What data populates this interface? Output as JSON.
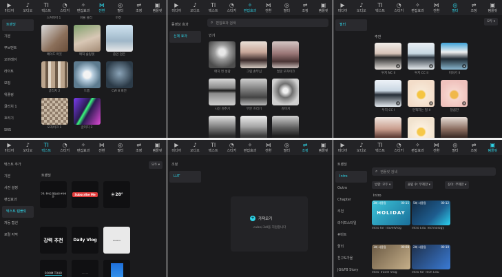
{
  "tabs": [
    "미디어",
    "오디오",
    "텍스트",
    "스티커",
    "편집효과",
    "전환",
    "필터",
    "조정",
    "템플릿"
  ],
  "tab_icons": [
    "▶",
    "♪",
    "TI",
    "◔",
    "✧",
    "⋈",
    "◎",
    "⇌",
    "▣"
  ],
  "p1": {
    "active_tab": 5,
    "sidebar": [
      "트렌딩",
      "기본",
      "무브먼트",
      "오버레이",
      "라이트",
      "모핑",
      "위플링",
      "글리치 1",
      "흐리기",
      "SNS",
      "일리"
    ],
    "active_side": 0,
    "top_caps": [
      "스커피아 1",
      "비율 블러",
      "버전"
    ],
    "captions": [
      "페이드 아웃",
      "매직 슬링엣",
      "줌인 검은",
      "글리치 2",
      "드롭",
      "CW 8 회전",
      "모자이크 1",
      "글리치 3"
    ]
  },
  "p2": {
    "active_tab": 4,
    "sidebar": [
      "동영상 효과",
      "신체 효과"
    ],
    "active_side": 1,
    "search_placeholder": "편집효과 검색",
    "section": "인기",
    "captions": [
      "매치 컷 성광",
      "그림 손부심",
      "얼굴 모자이크",
      "시선 검추기",
      "부분 흐리기",
      "감미치"
    ]
  },
  "p3": {
    "active_tab": 6,
    "sidebar": [
      "필터"
    ],
    "active_side": 0,
    "filter_all": "모두",
    "section": "추천",
    "captions": [
      "투지 NC II",
      "투지 CC II",
      "미야기 II",
      "투지 CC I",
      "먼젝지는 필 II",
      "달콤한"
    ]
  },
  "p4": {
    "active_tab": 2,
    "sidebar": [
      "텍스트 추가",
      "기본",
      "사전 설정",
      "편집효과",
      "텍스트 템플릿",
      "자동 캡션",
      "로컬 자막"
    ],
    "active_side": 4,
    "filter_all": "모두",
    "section": "트렌딩",
    "cards": {
      "subscribe_small": "구독, 좋아요 알림설정 부탁해요!",
      "yt_label": "Subscribe Me",
      "temp": "28°",
      "hanja": "강력 추천",
      "daily": "Daily Vlog",
      "room": "ROOM TOUR"
    }
  },
  "p5": {
    "active_tab": 7,
    "sidebar": [
      "조정",
      "LUT"
    ],
    "active_side": 1,
    "import_label": "가져오기",
    "import_hint": ".cube/.3dl을 지원합니다"
  },
  "p6": {
    "active_tab": 8,
    "sidebar": [
      "트렌딩",
      "Intro",
      "Outro",
      "Chapter",
      "추천",
      "라이프스타일",
      "#비트",
      "할리",
      "친구&가을",
      "JG&FB Story",
      "JG Feed"
    ],
    "active_side": 1,
    "search_placeholder": "템플릿 검색",
    "filters": [
      "방향: 모두",
      "클립 수: 무제한",
      "길이: 무제한"
    ],
    "section": "Intro",
    "cards": [
      {
        "title": "Intro for TravelVlog",
        "badge": "3회 사용됨",
        "time": "00:15",
        "art": "HOLIDAY"
      },
      {
        "title": "Intro Edu Technology",
        "badge": "5회 사용됨",
        "time": "00:12",
        "art": ""
      },
      {
        "title": "Intro Travel Vlog",
        "badge": "1회 사용됨",
        "time": "00:08",
        "art": ""
      },
      {
        "title": "Intro for Tech Edu",
        "badge": "2회 사용됨",
        "time": "00:10",
        "art": ""
      }
    ]
  }
}
